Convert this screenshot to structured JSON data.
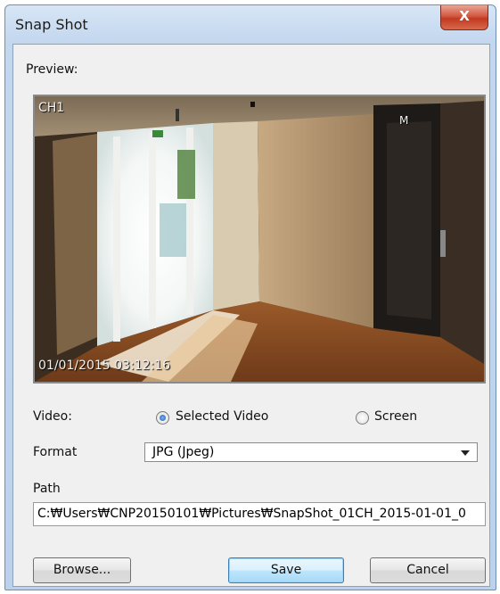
{
  "window": {
    "title": "Snap Shot",
    "close_glyph": "X"
  },
  "preview": {
    "label": "Preview:",
    "channel_label": "CH1",
    "timestamp": "01/01/2015 03:12:16",
    "elevator_sign": "M"
  },
  "video": {
    "label": "Video:",
    "options": [
      {
        "label": "Selected Video",
        "selected": true
      },
      {
        "label": "Screen",
        "selected": false
      }
    ]
  },
  "format": {
    "label": "Format",
    "value": "JPG (Jpeg)"
  },
  "path": {
    "label": "Path",
    "value": "C:₩Users₩CNP20150101₩Pictures₩SnapShot_01CH_2015-01-01_0"
  },
  "buttons": {
    "browse": "Browse...",
    "save": "Save",
    "cancel": "Cancel"
  },
  "colors": {
    "accent": "#3c7fb1",
    "close": "#c23a22"
  }
}
